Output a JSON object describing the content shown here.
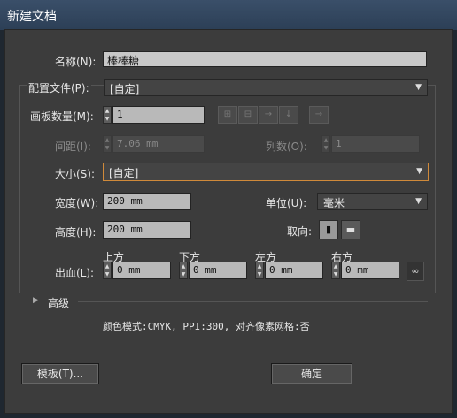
{
  "window": {
    "title": "新建文档"
  },
  "name": {
    "label": "名称(N):",
    "value": "棒棒糖"
  },
  "profile": {
    "label": "配置文件(P):",
    "value": "[自定]"
  },
  "artboards": {
    "count_label": "画板数量(M):",
    "count_value": "1",
    "spacing_label": "间距(I):",
    "spacing_value": "7.06 mm",
    "columns_label": "列数(O):",
    "columns_value": "1",
    "arrangement_icons": [
      "grid-by-row-icon",
      "grid-by-column-icon",
      "arrange-by-row-icon",
      "arrange-by-column-icon",
      "right-to-left-icon"
    ]
  },
  "size": {
    "label": "大小(S):",
    "value": "[自定]"
  },
  "width": {
    "label": "宽度(W):",
    "value": "200 mm"
  },
  "height": {
    "label": "高度(H):",
    "value": "200 mm"
  },
  "units": {
    "label": "单位(U):",
    "value": "毫米"
  },
  "orientation": {
    "label": "取向:",
    "selected": "portrait"
  },
  "bleed": {
    "label": "出血(L):",
    "top_label": "上方",
    "top_value": "0 mm",
    "bottom_label": "下方",
    "bottom_value": "0 mm",
    "left_label": "左方",
    "left_value": "0 mm",
    "right_label": "右方",
    "right_value": "0 mm"
  },
  "advanced": {
    "label": "高级"
  },
  "info": {
    "text": "颜色模式:CMYK, PPI:300, 对齐像素网格:否"
  },
  "buttons": {
    "templates": "模板(T)...",
    "ok": "确定"
  },
  "colors": {
    "dialog_bg": "#3c3c3c",
    "focus_border": "#d08a3a",
    "titlebar": "#34495f"
  }
}
